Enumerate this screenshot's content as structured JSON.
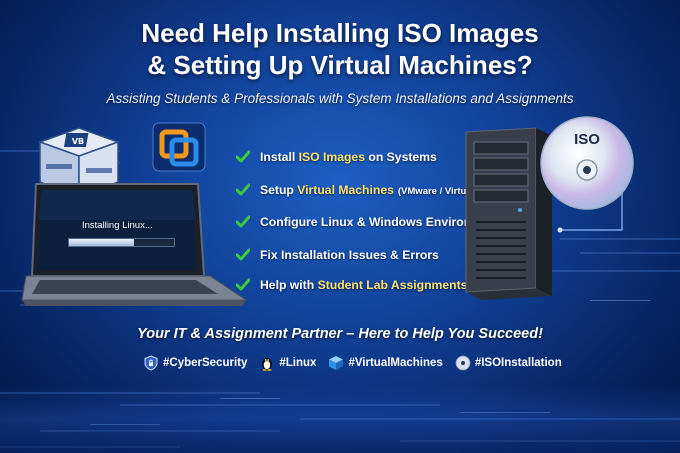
{
  "title": {
    "line1": "Need Help Installing ISO Images",
    "line2": "& Setting Up Virtual Machines?"
  },
  "subtitle": "Assisting Students & Professionals with System Installations and Assignments",
  "laptop": {
    "screen_text": "Installing Linux...",
    "progress": 0.62
  },
  "logos": {
    "virtualbox": "virtualbox-logo",
    "vmware": "vmware-logo"
  },
  "checklist": [
    {
      "before": "Install ",
      "highlight": "ISO Images",
      "after": " on Systems",
      "note": ""
    },
    {
      "before": "Setup ",
      "highlight": "Virtual Machines",
      "after": "",
      "note": "(VMware / VirtualBox)"
    },
    {
      "before": "Configure Linux & Windows Environments",
      "highlight": "",
      "after": "",
      "note": ""
    },
    {
      "before": "Fix Installation Issues & Errors",
      "highlight": "",
      "after": "",
      "note": ""
    },
    {
      "before": "Help with ",
      "highlight": "Student Lab Assignments",
      "after": "",
      "note": ""
    }
  ],
  "disc_label": "ISO",
  "tagline": "Your IT & Assignment Partner – Here to Help You Succeed!",
  "hashtags": [
    {
      "icon": "shield-lock-icon",
      "text": "#CyberSecurity"
    },
    {
      "icon": "linux-penguin-icon",
      "text": "#Linux"
    },
    {
      "icon": "cube-icon",
      "text": "#VirtualMachines"
    },
    {
      "icon": "disc-icon",
      "text": "#ISOInstallation"
    }
  ],
  "colors": {
    "background": "#0f3c8f",
    "highlight": "#ffe36a",
    "check": "#3ecb3a",
    "text": "#ffffff"
  }
}
